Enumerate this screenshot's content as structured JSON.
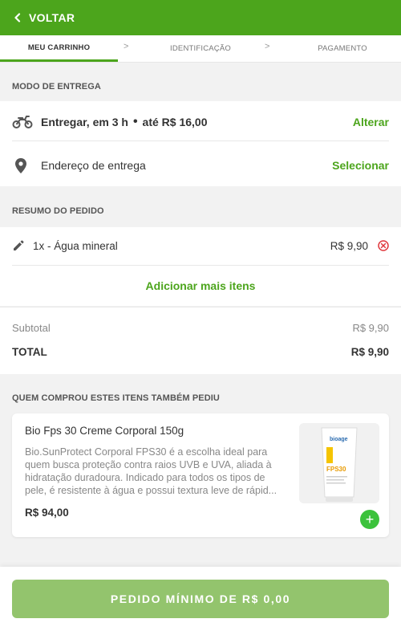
{
  "header": {
    "back_label": "VOLTAR"
  },
  "steps": [
    {
      "label": "MEU CARRINHO",
      "active": true
    },
    {
      "label": "IDENTIFICAÇÃO",
      "active": false
    },
    {
      "label": "PAGAMENTO",
      "active": false
    }
  ],
  "step_separator": ">",
  "delivery": {
    "section_title": "MODO DE ENTREGA",
    "mode_text": "Entregar, em 3 h",
    "dot": "•",
    "price_text": "até R$ 16,00",
    "mode_action": "Alterar",
    "address_label": "Endereço de entrega",
    "address_action": "Selecionar"
  },
  "order": {
    "section_title": "RESUMO DO PEDIDO",
    "items": [
      {
        "label": "1x - Água mineral",
        "price": "R$ 9,90"
      }
    ],
    "add_more": "Adicionar mais itens",
    "subtotal_label": "Subtotal",
    "subtotal_value": "R$ 9,90",
    "total_label": "TOTAL",
    "total_value": "R$ 9,90"
  },
  "recommendations": {
    "section_title": "QUEM COMPROU ESTES ITENS TAMBÉM PEDIU",
    "product": {
      "title": "Bio Fps 30 Creme Corporal 150g",
      "description": "Bio.SunProtect Corporal FPS30 é a escolha ideal para quem busca proteção contra raios UVB e UVA, aliada à hidratação duradoura. Indicado para todos os tipos de pele, é resistente à água e possui textura leve de rápid...",
      "price": "R$ 94,00",
      "add_symbol": "+",
      "image_brand": "bioage",
      "image_badge": "FPS30"
    }
  },
  "footer": {
    "cta_label": "PEDIDO MÍNIMO DE R$ 0,00"
  },
  "colors": {
    "brand_green": "#4ca51c",
    "cta_green": "#93c46d",
    "remove_red": "#e0393e",
    "add_green": "#3cc23c"
  }
}
